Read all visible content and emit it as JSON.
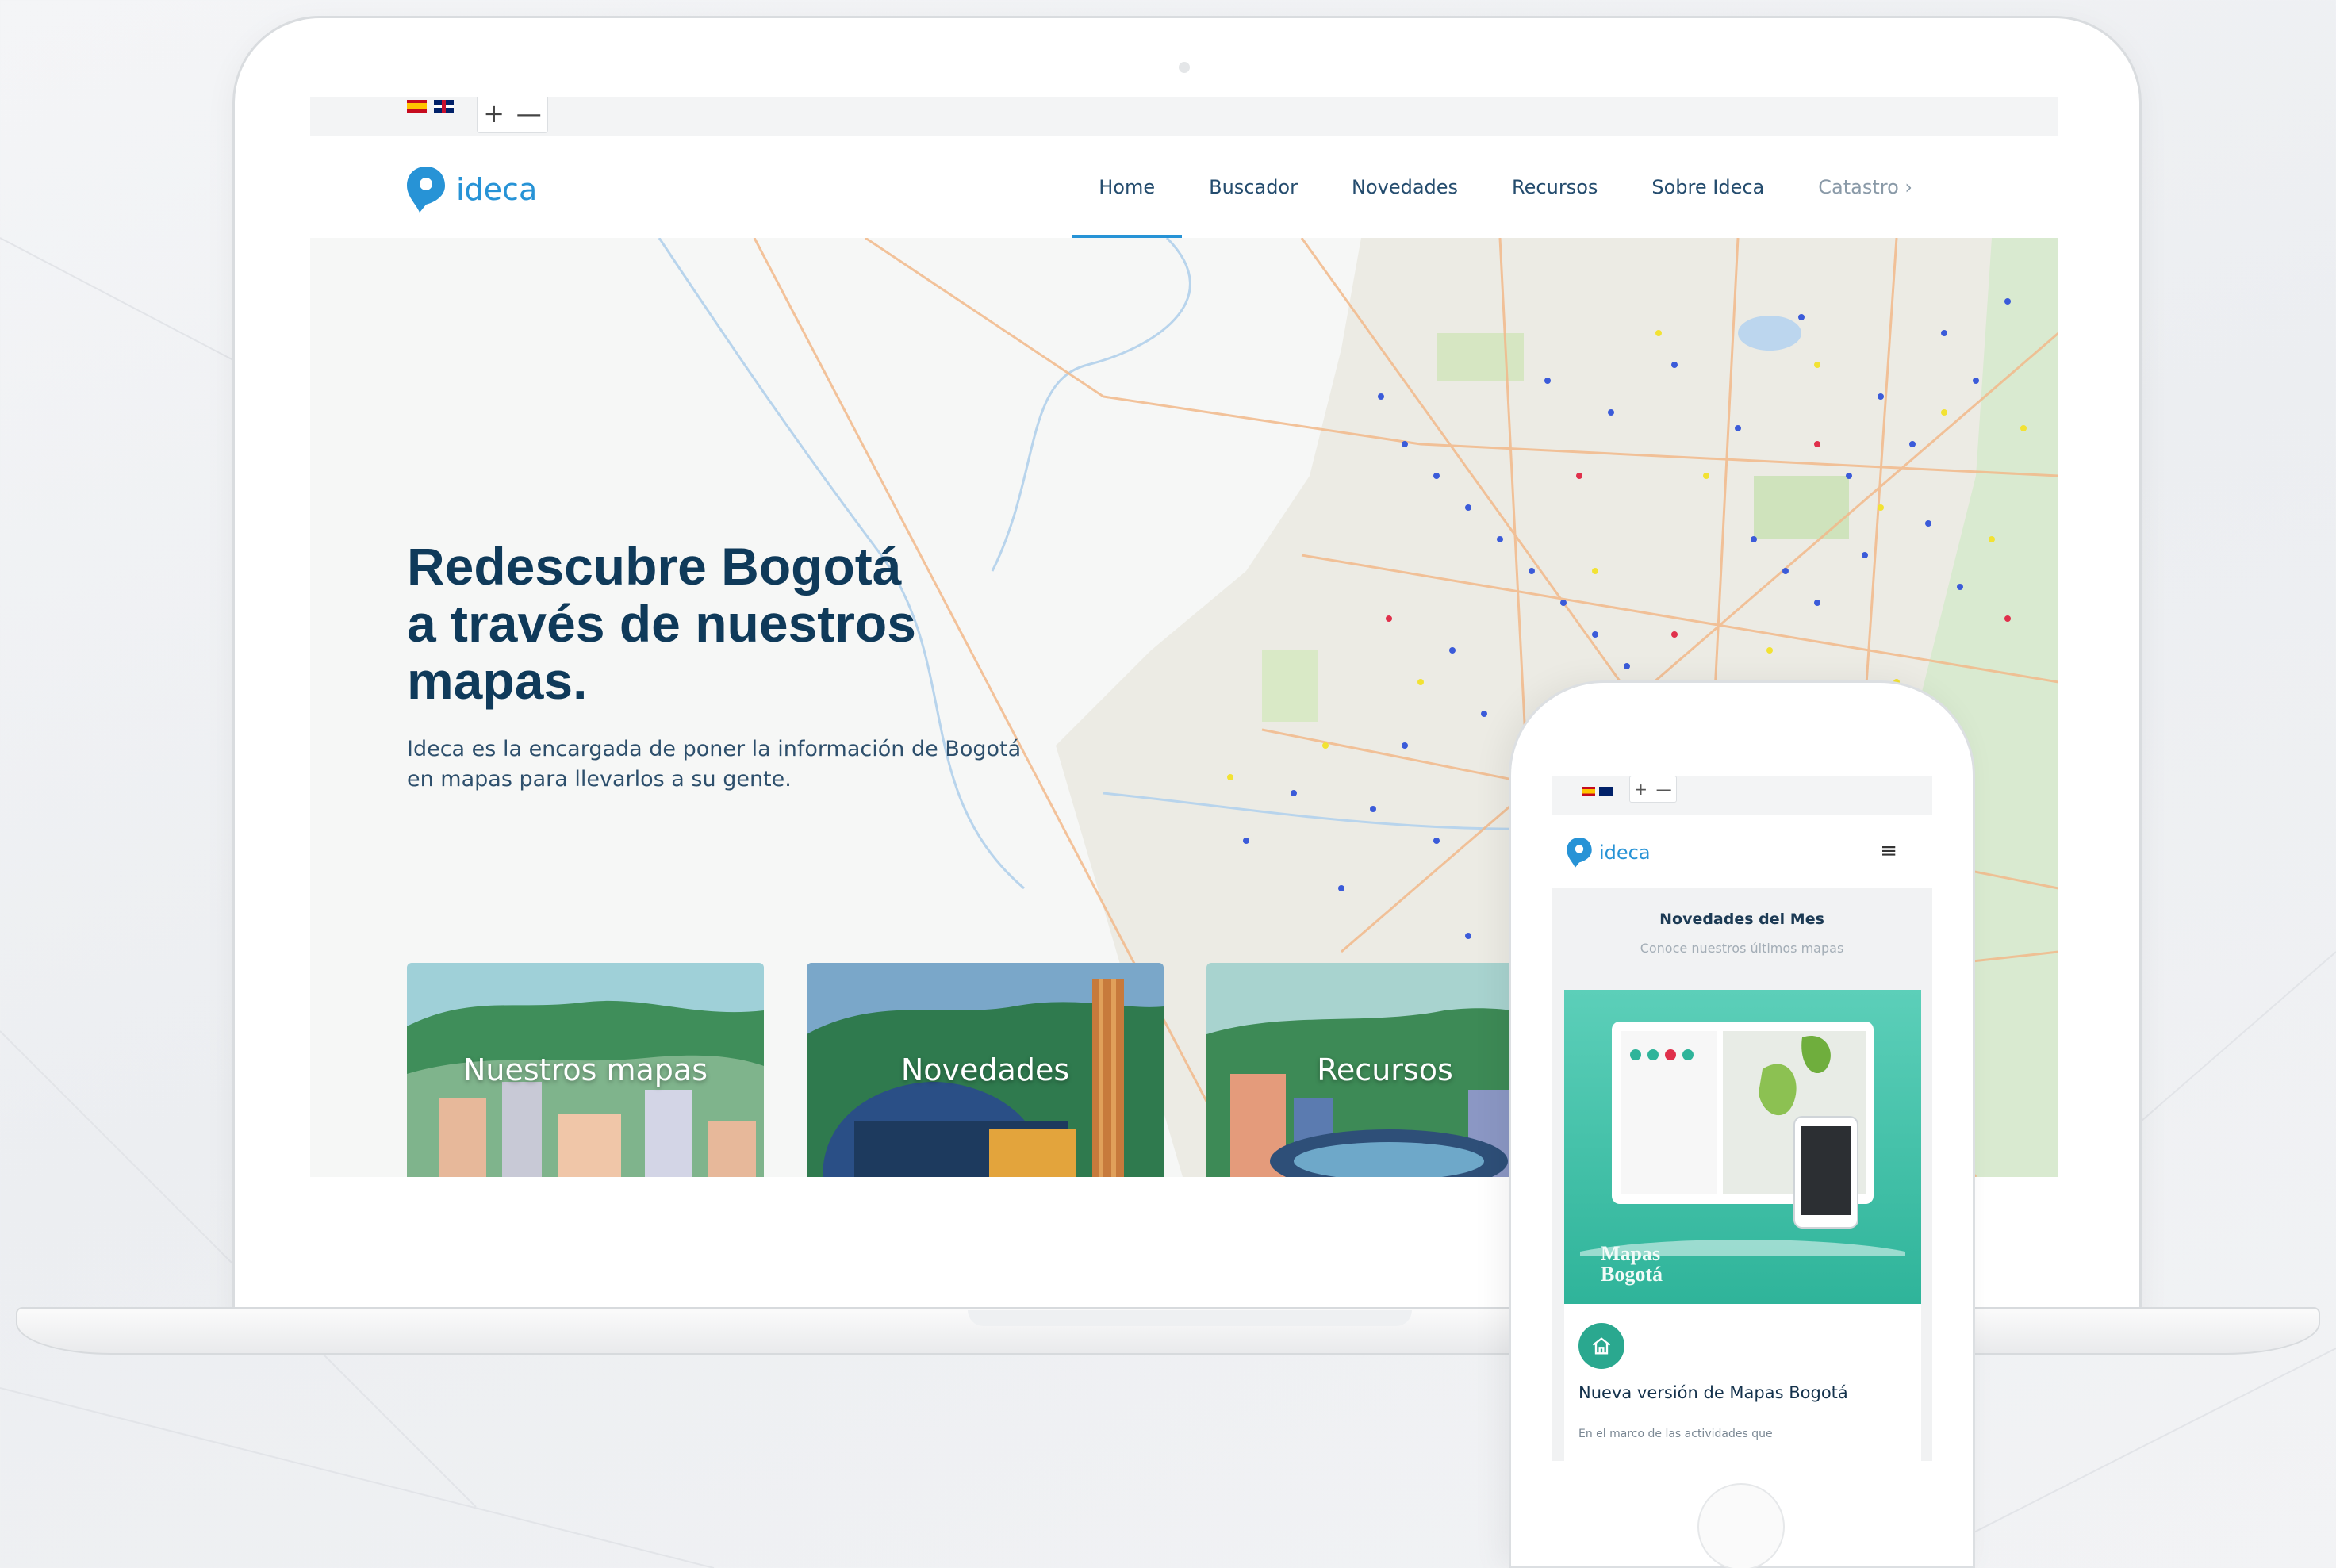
{
  "laptop": {
    "lang_flags": [
      "es",
      "uk"
    ],
    "zoom": {
      "plus": "+",
      "minus": "—"
    },
    "logo_text": "ideca",
    "nav": [
      "Home",
      "Buscador",
      "Novedades",
      "Recursos",
      "Sobre Ideca",
      "Catastro ›"
    ],
    "active_nav": "Home",
    "hero": {
      "title": "Redescubre Bogotá\na través de nuestros\nmapas.",
      "description": "Ideca es la encargada de poner la información de Bogotá en mapas para llevarlos a su gente."
    },
    "cards": [
      "Nuestros mapas",
      "Novedades",
      "Recursos"
    ]
  },
  "phone": {
    "zoom": {
      "plus": "+",
      "minus": "—"
    },
    "logo_text": "ideca",
    "menu_icon": "≡",
    "section_title": "Novedades del Mes",
    "section_subtitle": "Conoce nuestros últimos mapas",
    "card_image_text": "Mapas Bogotá",
    "card_title": "Nueva versión de Mapas Bogotá",
    "card_text": "En el marco de las actividades que"
  },
  "colors": {
    "brand_blue": "#2793d6",
    "title_navy": "#0f3a5a",
    "teal_badge": "#2aa88f"
  }
}
